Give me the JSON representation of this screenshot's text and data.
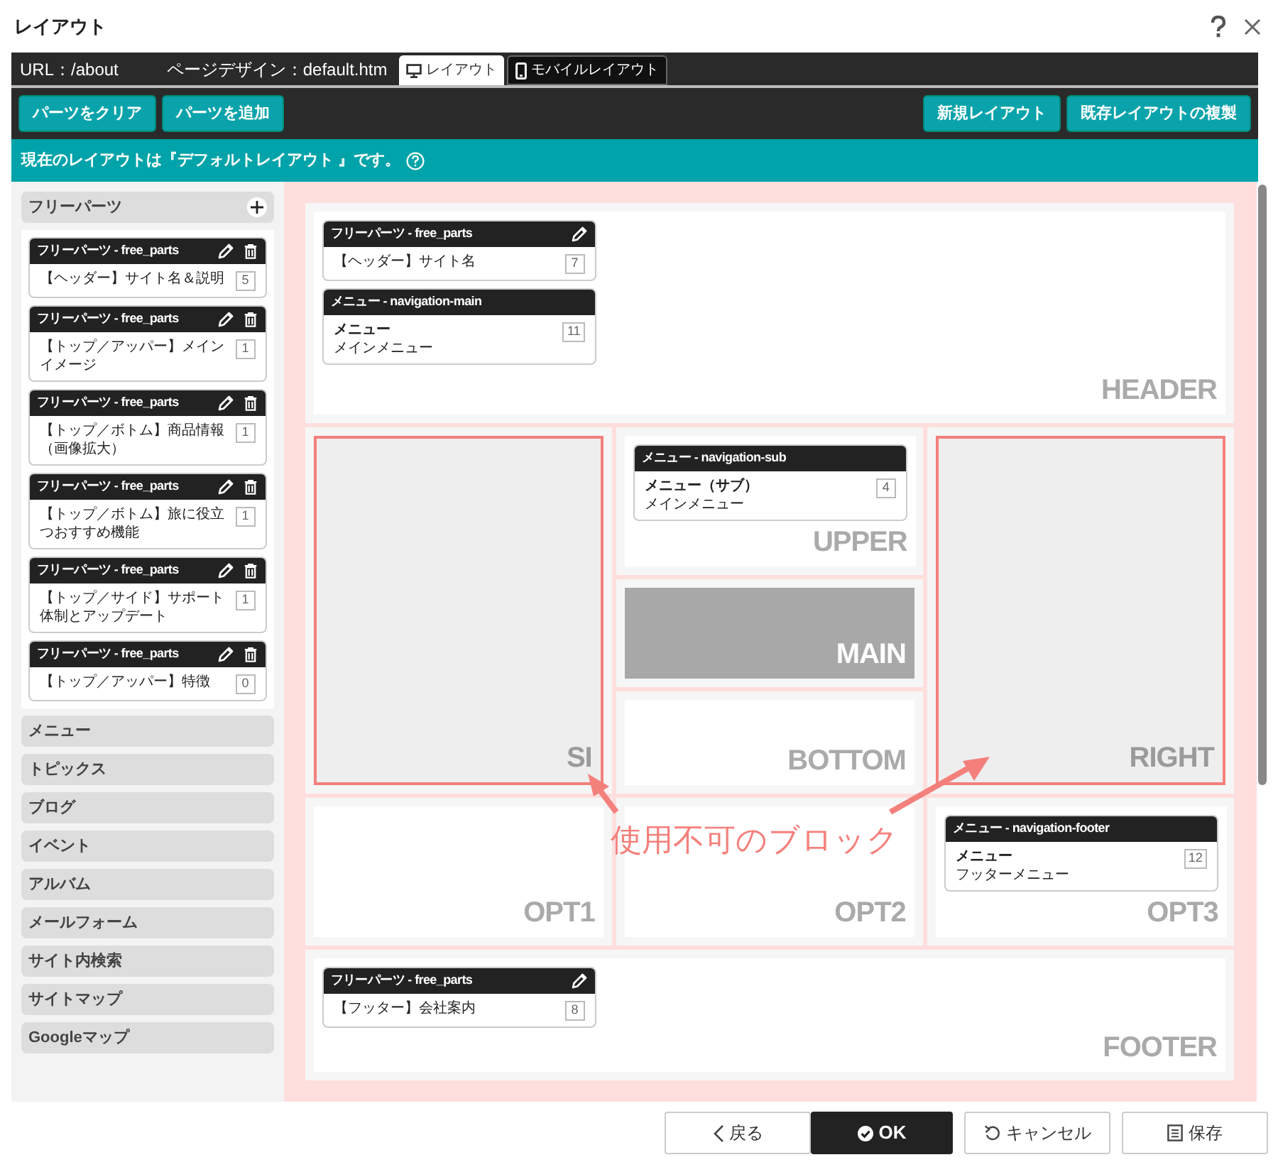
{
  "window": {
    "title": "レイアウト"
  },
  "info": {
    "url": "URL：/about",
    "design": "ページデザイン：default.htm"
  },
  "tabs": [
    {
      "label": "レイアウト",
      "kind": "monitor",
      "selected": true
    },
    {
      "label": "モバイルレイアウト",
      "kind": "phone",
      "selected": false
    }
  ],
  "toolbar": {
    "left": [
      "パーツをクリア",
      "パーツを追加"
    ],
    "right": [
      "新規レイアウト",
      "既存レイアウトの複製"
    ]
  },
  "notice": "現在のレイアウトは『デフォルトレイアウト 』です。",
  "sidebar": {
    "groups": [
      {
        "label": "フリーパーツ",
        "expanded": true,
        "parts": [
          {
            "header": "フリーパーツ - free_parts",
            "text": "【ヘッダー】サイト名＆説明",
            "count": "5",
            "edit": true,
            "delete": true
          },
          {
            "header": "フリーパーツ - free_parts",
            "text": "【トップ／アッパー】メインイメージ",
            "count": "1",
            "edit": true,
            "delete": true
          },
          {
            "header": "フリーパーツ - free_parts",
            "text": "【トップ／ボトム】商品情報（画像拡大）",
            "count": "1",
            "edit": true,
            "delete": true
          },
          {
            "header": "フリーパーツ - free_parts",
            "text": "【トップ／ボトム】旅に役立つおすすめ機能",
            "count": "1",
            "edit": true,
            "delete": true
          },
          {
            "header": "フリーパーツ - free_parts",
            "text": "【トップ／サイド】サポート体制とアップデート",
            "count": "1",
            "edit": true,
            "delete": true
          },
          {
            "header": "フリーパーツ - free_parts",
            "text": "【トップ／アッパー】特徴",
            "count": "0",
            "edit": true,
            "delete": true
          }
        ]
      },
      {
        "label": "メニュー",
        "expanded": false
      },
      {
        "label": "トピックス",
        "expanded": false
      },
      {
        "label": "ブログ",
        "expanded": false
      },
      {
        "label": "イベント",
        "expanded": false
      },
      {
        "label": "アルバム",
        "expanded": false
      },
      {
        "label": "メールフォーム",
        "expanded": false
      },
      {
        "label": "サイト内検索",
        "expanded": false
      },
      {
        "label": "サイトマップ",
        "expanded": false
      },
      {
        "label": "Googleマップ",
        "expanded": false
      }
    ]
  },
  "regions": [
    {
      "label": "HEADER",
      "disabled": false,
      "shaded": false,
      "parts": [
        {
          "header": "フリーパーツ - free_parts",
          "text": "【ヘッダー】サイト名",
          "count": "7",
          "edit": true,
          "delete": false
        },
        {
          "header": "メニュー - navigation-main",
          "title": "メニュー",
          "text": "メインメニュー",
          "count": "11",
          "edit": false,
          "delete": false
        }
      ]
    },
    {
      "label": "SI",
      "disabled": true,
      "shaded": false
    },
    {
      "label": "UPPER",
      "disabled": false,
      "shaded": false,
      "parts": [
        {
          "header": "メニュー - navigation-sub",
          "title": "メニュー（サブ）",
          "text": "メインメニュー",
          "count": "4",
          "edit": false,
          "delete": false
        }
      ]
    },
    {
      "label": "MAIN",
      "disabled": false,
      "shaded": true
    },
    {
      "label": "BOTTOM",
      "disabled": false,
      "shaded": false
    },
    {
      "label": "RIGHT",
      "disabled": true,
      "shaded": false
    },
    {
      "label": "OPT1",
      "disabled": false,
      "shaded": false
    },
    {
      "label": "OPT2",
      "disabled": false,
      "shaded": false
    },
    {
      "label": "OPT3",
      "disabled": false,
      "shaded": false,
      "parts": [
        {
          "header": "メニュー - navigation-footer",
          "title": "メニュー",
          "text": "フッターメニュー",
          "count": "12",
          "edit": false,
          "delete": false
        }
      ]
    },
    {
      "label": "FOOTER",
      "disabled": false,
      "shaded": false,
      "parts": [
        {
          "header": "フリーパーツ - free_parts",
          "text": "【フッター】会社案内",
          "count": "8",
          "edit": true,
          "delete": false
        }
      ]
    }
  ],
  "annotation": "使用不可のブロック",
  "buttons": [
    {
      "label": "戻る",
      "kind": "back"
    },
    {
      "label": "OK",
      "kind": "ok"
    },
    {
      "label": "キャンセル",
      "kind": "cancel"
    },
    {
      "label": "保存",
      "kind": "save"
    }
  ]
}
